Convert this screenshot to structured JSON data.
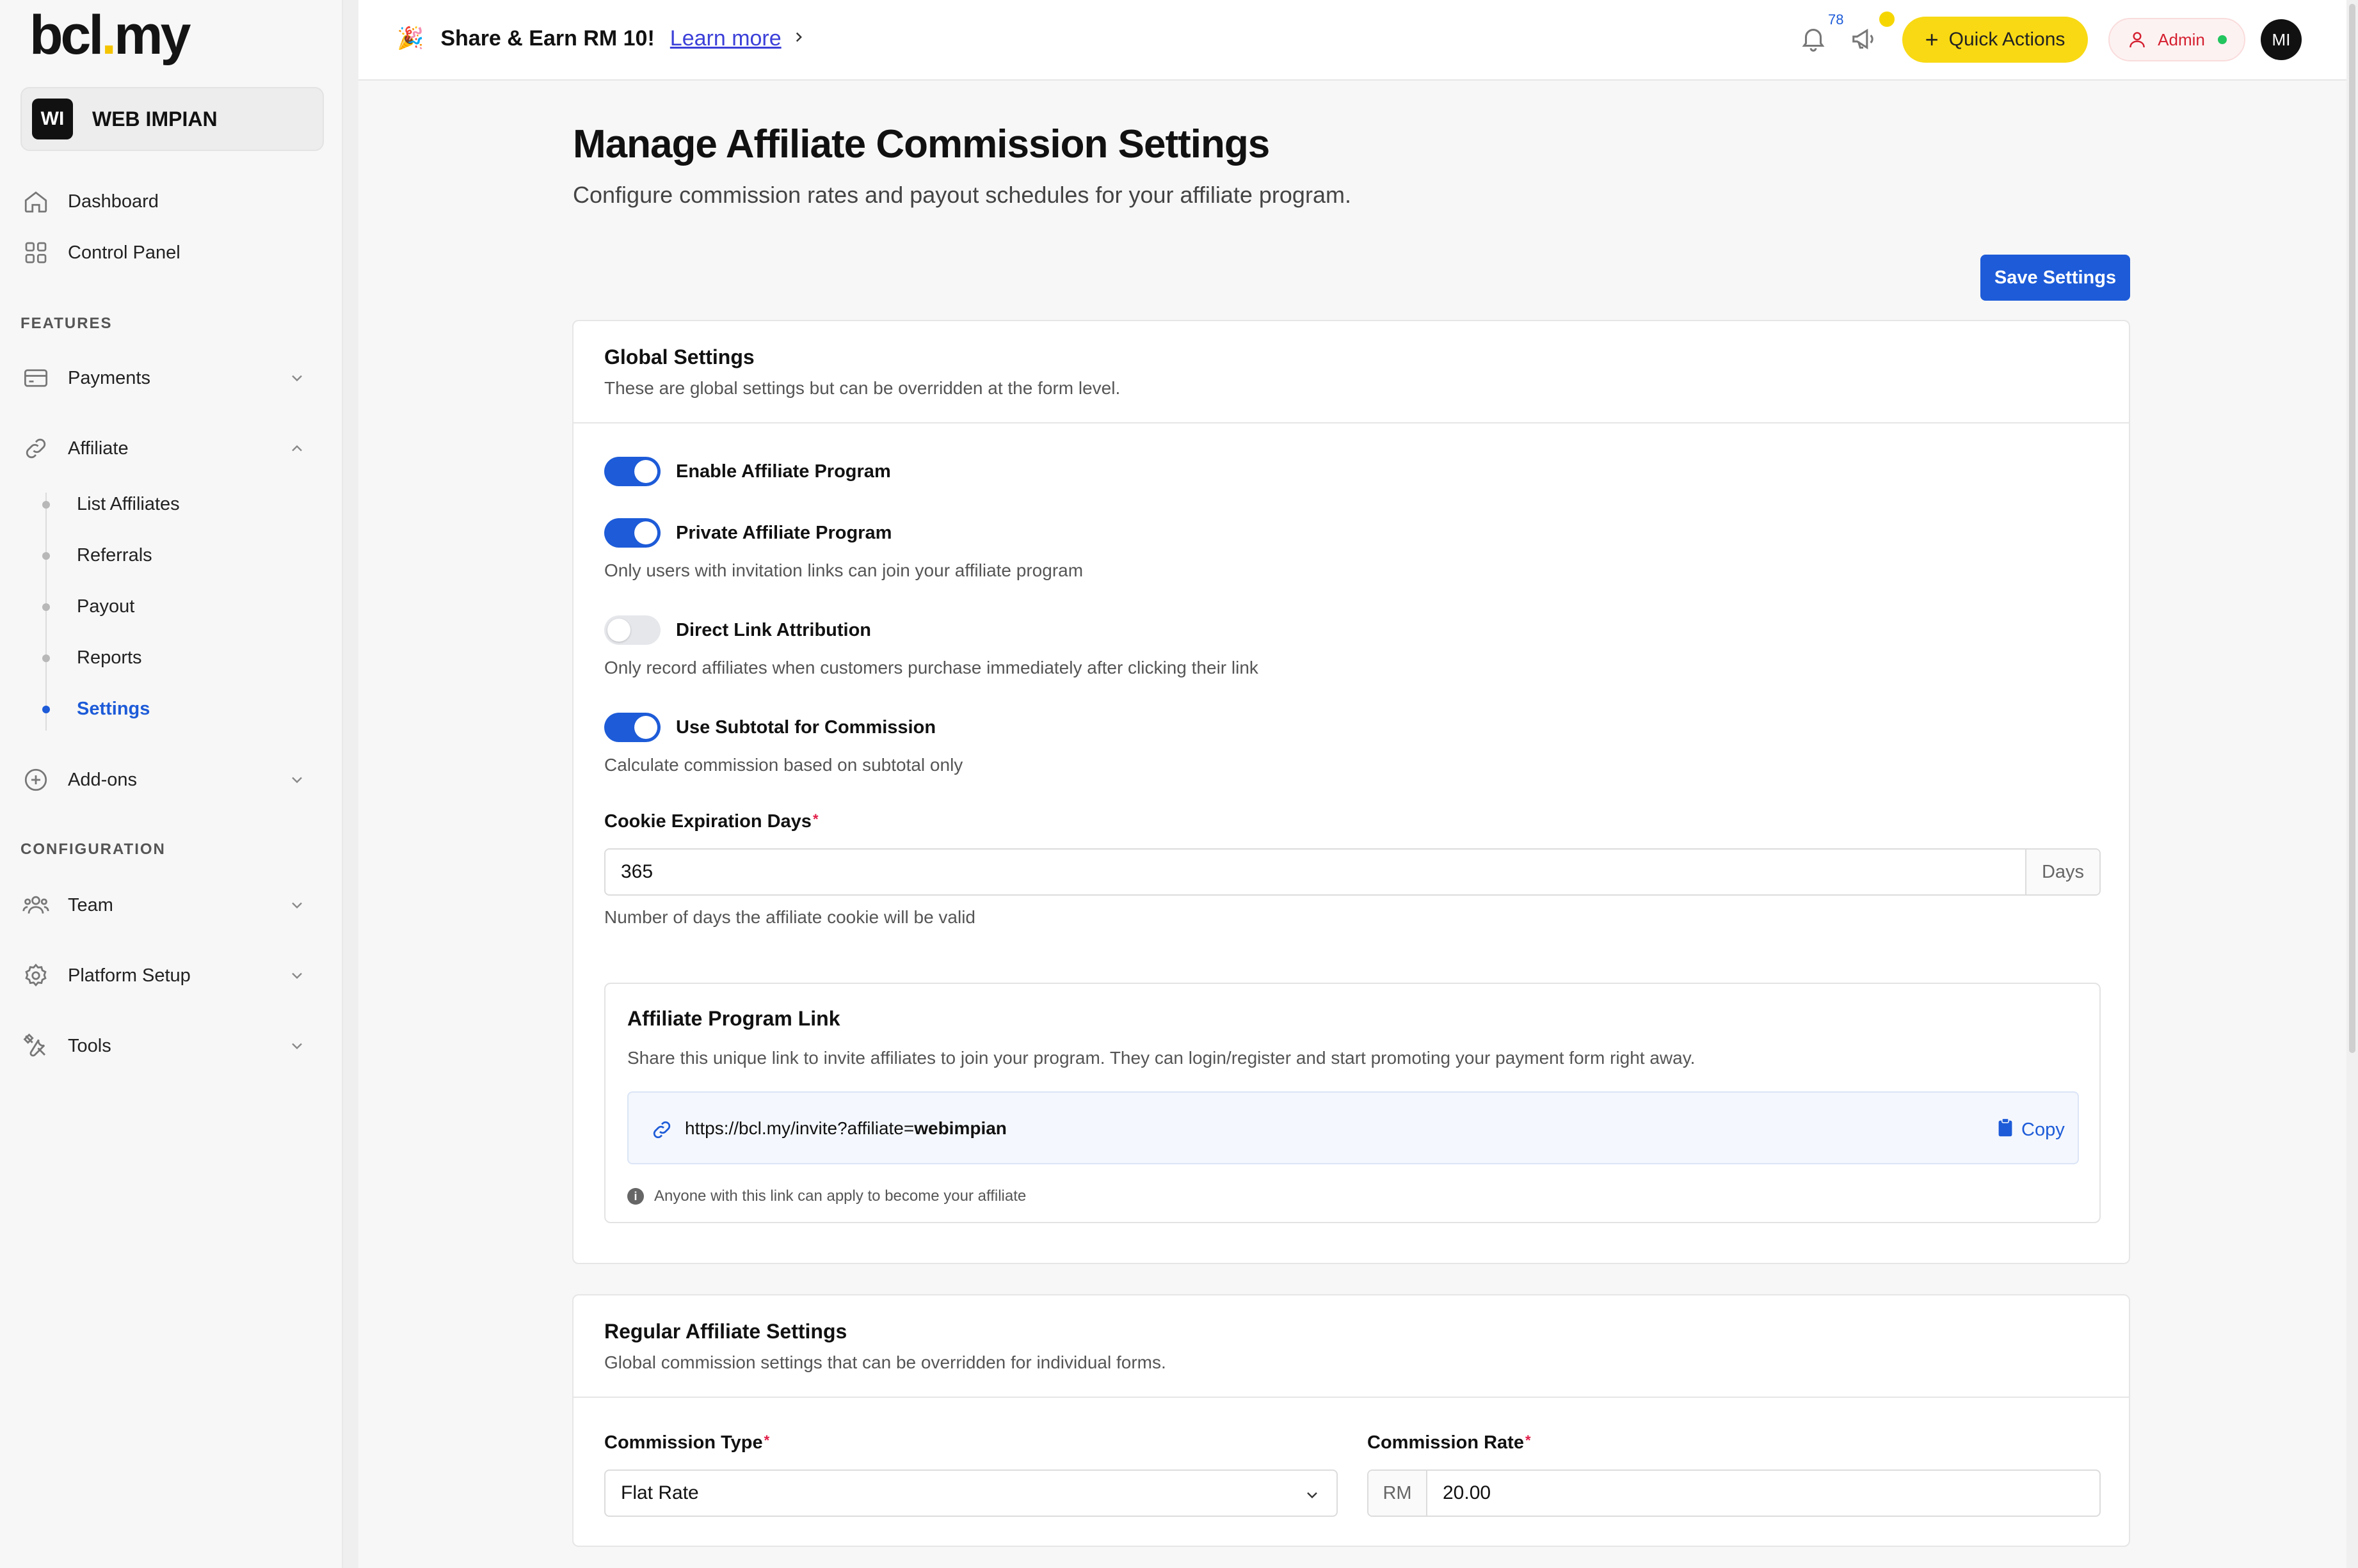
{
  "brand": {
    "logo_text_a": "bcl",
    "logo_dot": ".",
    "logo_text_b": "my",
    "accent": "#f5c400"
  },
  "workspace": {
    "initials": "WI",
    "name": "WEB IMPIAN"
  },
  "sidebar": {
    "dashboard": "Dashboard",
    "control_panel": "Control Panel",
    "features_label": "FEATURES",
    "payments": "Payments",
    "affiliate": "Affiliate",
    "affiliate_sub": [
      "List Affiliates",
      "Referrals",
      "Payout",
      "Reports",
      "Settings"
    ],
    "addons": "Add-ons",
    "configuration_label": "CONFIGURATION",
    "team": "Team",
    "platform_setup": "Platform Setup",
    "tools": "Tools"
  },
  "topbar": {
    "promo_emoji": "🎉",
    "promo_title": "Share & Earn RM 10!",
    "promo_link": "Learn more",
    "notification_count": "78",
    "quick_actions": "Quick Actions",
    "admin_label": "Admin",
    "avatar_initials": "MI"
  },
  "page": {
    "title": "Manage Affiliate Commission Settings",
    "subtitle": "Configure commission rates and payout schedules for your affiliate program.",
    "save_button": "Save Settings"
  },
  "global_settings": {
    "title": "Global Settings",
    "description": "These are global settings but can be overridden at the form level.",
    "toggles": [
      {
        "label": "Enable Affiliate Program",
        "on": true,
        "helper": ""
      },
      {
        "label": "Private Affiliate Program",
        "on": true,
        "helper": "Only users with invitation links can join your affiliate program"
      },
      {
        "label": "Direct Link Attribution",
        "on": false,
        "helper": "Only record affiliates when customers purchase immediately after clicking their link"
      },
      {
        "label": "Use Subtotal for Commission",
        "on": true,
        "helper": "Calculate commission based on subtotal only"
      }
    ],
    "cookie_label": "Cookie Expiration Days",
    "required_mark": "*",
    "cookie_value": "365",
    "cookie_suffix": "Days",
    "cookie_helper": "Number of days the affiliate cookie will be valid"
  },
  "program_link": {
    "title": "Affiliate Program Link",
    "description": "Share this unique link to invite affiliates to join your program. They can login/register and start promoting your payment form right away.",
    "url_prefix": "https://bcl.my/invite?affiliate=",
    "url_slug": "webimpian",
    "copy_label": "Copy",
    "note_icon": "i",
    "note": "Anyone with this link can apply to become your affiliate"
  },
  "regular_settings": {
    "title": "Regular Affiliate Settings",
    "description": "Global commission settings that can be overridden for individual forms.",
    "commission_type_label": "Commission Type",
    "commission_type_value": "Flat Rate",
    "commission_rate_label": "Commission Rate",
    "commission_rate_prefix": "RM",
    "commission_rate_value": "20.00"
  },
  "colors": {
    "primary": "#1d5bd8",
    "quick_actions": "#f8d914",
    "admin": "#d41f2f",
    "online": "#22c55e"
  }
}
